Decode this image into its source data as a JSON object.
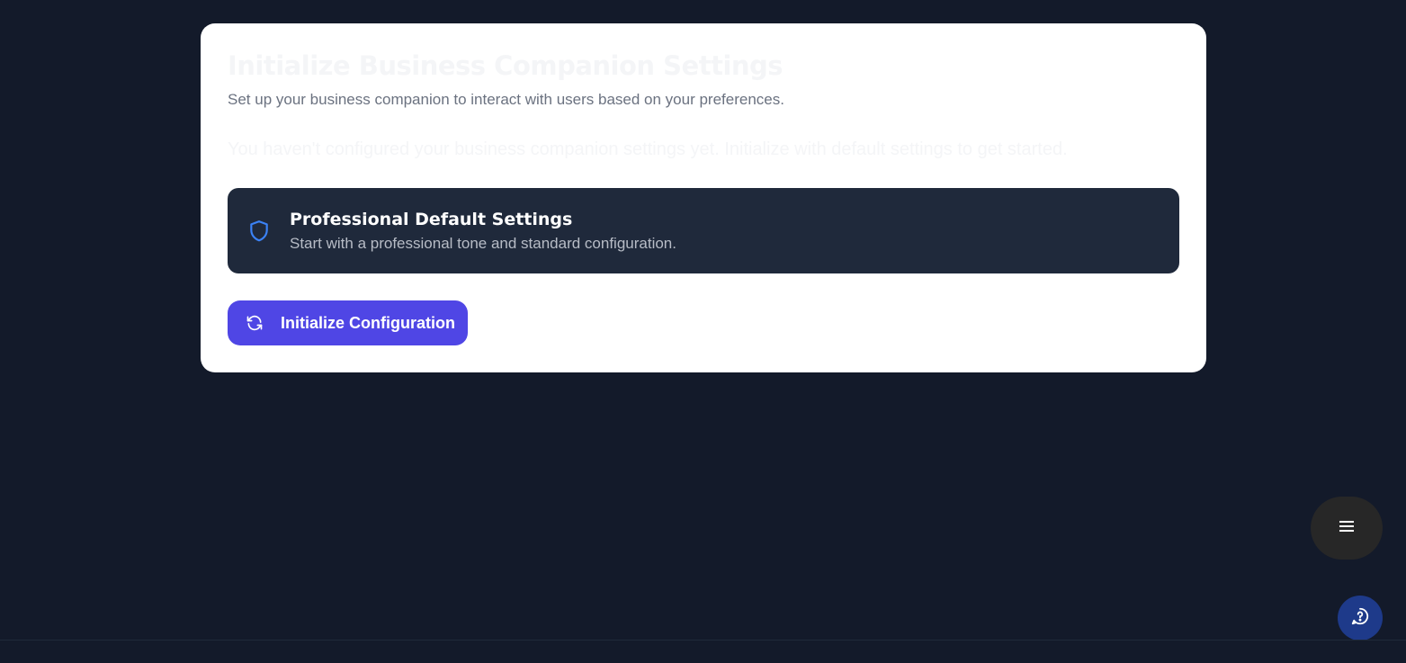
{
  "card": {
    "title": "Initialize Business Companion Settings",
    "subtitle": "Set up your business companion to interact with users based on your preferences.",
    "notice": "You haven't configured your business companion settings yet. Initialize with default settings to get started."
  },
  "option": {
    "icon": "shield-icon",
    "title": "Professional Default Settings",
    "description": "Start with a professional tone and standard configuration."
  },
  "actions": {
    "initialize_icon": "refresh-icon",
    "initialize_label": "Initialize Configuration"
  },
  "floating": {
    "menu_icon": "menu-icon",
    "help_icon": "help-chat-icon"
  },
  "colors": {
    "background": "#131a2a",
    "card": "#ffffff",
    "option_bg": "#1f293b",
    "accent": "#4f46e5",
    "shield": "#3b82f6",
    "help_button": "#1e3a8a"
  }
}
